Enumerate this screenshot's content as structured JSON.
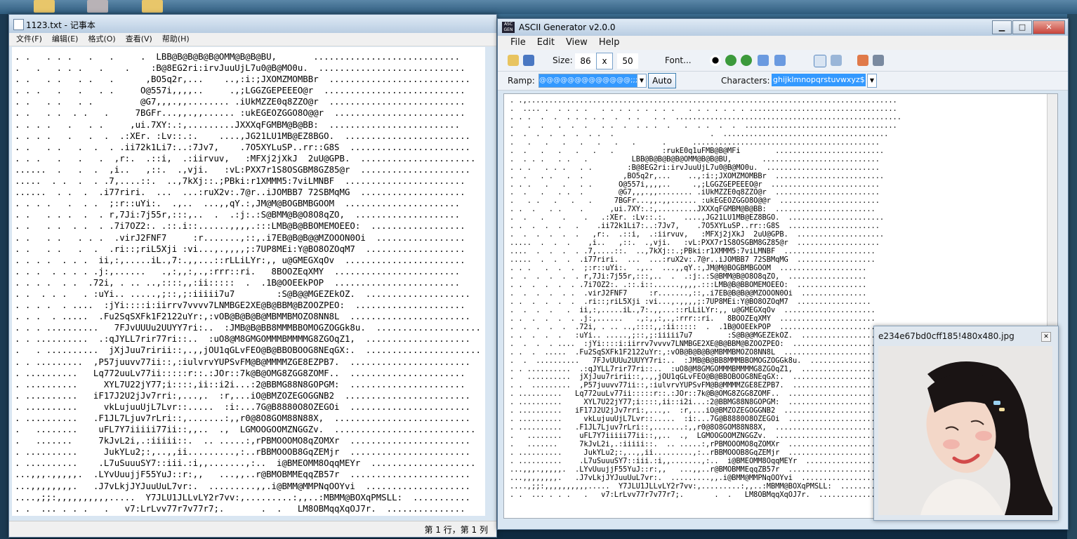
{
  "notepad": {
    "title": "1123.txt - 记事本",
    "menu": [
      "文件(F)",
      "编辑(E)",
      "格式(O)",
      "查看(V)",
      "帮助(H)"
    ],
    "status": "第 1 行，第 1 列",
    "text": ". .   . . .   .   .     .  LBB@B@B@B@B@OMM@B@B@BU,       ............................\n.   .   . . .   .    .    :B@8EG2ri:irvJuuUjL7u0@B@MO0u.  ............................\n. .   . .   . .   .      ,BO5q2r,...    ..,:i:;JXOMZMOMBBr  ...........................\n. . .   .   .   . .     O@557i,,,,..     .,;LGGZGEPEEEO@r  ...........................\n. .   . .   . .         @G7,,,.,,........ .iUkMZZE0q8ZZO@r  ..........................\n. .   . .  . .   .     7BGFr...,,.,,...... :ukEGEOZGGO8O@@r  .........................\n. . . .   .   . .     ,ui.7XY:.:,.........JXXXqFGMBM@B@BB:  .........................\n. . . .   .   .  .  .:XEr. :Lv::.:.    ....,JG21LU1MB@EZ8BGO.  ........................\n. .   . .   .  .  . .ii72k1Li7:..:7Jv7,    .7O5XYLuSP..rr::G8S  .......................\n. . .   .   .   .  ,r:.  .::i,  .:iirvuv,   :MFXj2jXkJ  2uU@GPB.  ......................\n......  .   .  .  ,i..   ,::.  .,vji.   :vL:PXX7r1S8OSGBM8GZ85@r  .....................\n.....  . .  .  . .7,....::.  ..,7kXj::.;PBki:r1XMMM5:7viLMNBF  .......................\n......  . .  .  .i77riri.  ...  ...:ruX2v:.7@r..iJOMBB7 72SBMqMG  ....................\n. . . .   .  . .  ;:r::uYi:.  .,..  ...,,qY.:,JM@M@BOGBMBGOOM  ......................\n. .   . . .  .  . r,7Ji:7j55r,:::,..  .  .:j:.:S@BMM@B@O8O8qZO,  ....................\n. .   . .  . .  . .7i7OZ2:. .::.i::......,,,,.:::LMB@B@BBOMEMOEEO:  ..................\n. .   . .   . . .  .virJ2FNF7     :r.......,::,.i7EB@B@B@@MZOOON0Oi  .................\n. .   . .   .  .  .ri::;riL5Xji :vi...,.,,,,;:7UP8MEi:Y@BO8OZOqM7  ...................\n. . . .  . . .  ii,:,.....iL.,7:.,,...::rLLiLYr:,, u@GMEGXqOv  .......................\n. . .  . . . . .j:,......   .,:,,:,.,:rrr::ri.   8BOOZEqXMY  ........................\n. . . .  . .  .72i, . .. ..,::::,,:ii:::::  .  .1B@OOEEkPOP  ........................\n. .  . . .   . :uYi.. .....,;::,;:iiiii7u7        :S@B@@MGEZEkOZ.  ....................\n. . . .  . ....  :jYi::::i:iirrv7vvvv7LNMBGE2XE@B@BBM@BZOOZPEO:  .....................\n. . .  . .....  .Fu2SqSXFk1F2122uYr:,:vOB@B@B@B@MBMMBMOZO8NN8L  .......................\n. . . ..........   7FJvUUUu2UUYY7ri:..  :JMB@B@BB8MMMBBOMOGZOGGk8u.  ....................\n. . ..........  .:qJYLL7rir77ri::..  :uO8@M8GMGOMMMBMMMMG8ZGOqZ1,  ....................\n.   . ..........  jXjJuu7ririi::,.,,jOU1qGLvFEO@B@BBOBOOG8NEqGX:.  ......................\n. . .........  ,P57juuvv77ii::,:iulvrvYUPSvFM@B@MMMMZGE8EZPB7.  .......................\n. ..........   Lq772uuLv77ii:::::r::.:JOr::7k@B@OMG8ZGG8ZOMF..  ......................\n. ..........     XYL7U22jY77;i::::,ii::i2i...:2@BBMG88N8GOPGM:  ......................\n. ..........   iF17J2U2jJv7rri:,...,.  :r,...iO@BMZOZEGOGGNB2  ........................\n. ..........     vkLujuuUjL7Lvr::.....  :i:...7G@B8880O8OZEGOi  .......................\n. ..........   .F1JL7Ljuv7rLri::,.......:,,r0@8O8GOM88N88X,  ..........................\n.   ........    uFL7Y7iiiii77ii::,,..  .,  LGMOOGOOMZNGGZv.  ...........................\n.   .......     7kJvL2i,.:iiiii::.  .. .....:,rPBMOOOMO8qZOMXr  .......................\n. ..........     JukYLu2;:,..,,ii.........,:..rBBMOOOB8GqZEMjr  .......................\n. ..........    .L7uSuuuSY7::iii.:i,,.......,:..  i@BMEOMM8OqqMEYr  ....................\n...,,,.,,,,,.  .LYvUuujjF55YuJ::r:,,   ...,,..r@BMOBMMEqqZB57r  .......................\n...,,,,,,,,.   .J7vLkjJYJuuUuL7vr:.  .........,,.i@BMM@MMPNqOOYvi  ....................\n....,;;:,,,,,,,,,,.....  Y7JLU1JLLvLY2r7vv:,.........:,,..:MBMM@BOXqPMSLL:  ...........\n. .  ... . . .   .   v7:LrLvv77r7v77r7;.       .  .   LM8OBMqqXqOJ7r.  ..............."
  },
  "ascii_gen": {
    "title": "ASCII Generator v2.0.0",
    "menu": [
      "File",
      "Edit",
      "View",
      "Help"
    ],
    "size_label": "Size:",
    "width": "86",
    "x_label": "x",
    "height": "50",
    "font_label": "Font...",
    "ramp_label": "Ramp:",
    "ramp_value": "@@@@@@@@@@@@@;;;;,,,,,,,,,,",
    "auto_label": "Auto",
    "characters_label": "Characters:",
    "characters_value": "ghijklmnopqrstuvwxyz$",
    "output": ". .,.....................................................................................\n.  .... .  . . . .   . . . . . . . . .   . . . . . . . ..................................\n. . .  .  .  . . . . .  .  . .   . .  ....................................................\n.   .  .   .  .  .   . .  .  . . .  .   .  . .  .  .  ...................................\n.  .  .  .  .  .  . .  .                      .  ......................................\n.   .   .   .   .   .   .   .      .      ...........................................\n.  .   .   .   .   .   .           :rukE0q1uFMB@B@MFi        .........................\n.  . . .   . .   .          LBB@B@B@B@B@OMM@B@B@BU,       ...........................\n. . .   . . .   . .        :B@8EG2ri:irvJuuUjL7u0@B@MO0u.  ..........................\n.  .   . .   .  .         ,BO5q2r,...    ..,:i:;JXOMZMOMBBr  .........................\n. . .   .   .   . .      O@557i,,,,..     .,;LGGZGEPEEEO@r  .........................\n.  .   .   . .  .        @G7,,,.,,........ .iUkMZZE0q8ZZO@r  ........................\n.   . .   .   .   .     7BGFr...,,.,,...... :ukEGEOZGGO8O@@r  .......................\n. .  .   . .    .      ,ui.7XY:.:,.........JXXXqFGMBM@B@BB:  .......................\n.  .   .    .    .   .:XEr. :Lv::.:.    ....,JG21LU1MB@EZ8BGO.  ......................\n. .  .  .  .   .    .ii72k1Li7:..:7Jv7,    .7O5XYLuSP..rr::G8S  .....................\n.  .  .  .  .  .   ,r:.  .::i,  .:iirvuv,   :MFXj2jXkJ  2uU@GPB.  ....................\n.....  .  .  .    ,i..   ,::.  .,vji.   :vL:PXX7r1S8OSGBM8GZ85@r  ...................\n....  .  .  .  . .7,....::.  ..,7kXj::.;PBki:r1XMMM5:7viLMNBF  .....................\n.....  .  .  .  .i77riri.  ...  ...:ruX2v:.7@r..iJOMBB7 72SBMqMG  ..................\n. . .   .  .  .  ;:r::uYi:.  .,..  ...,,qY.:,JM@M@BOGBMBGOOM  ....................\n.  .  .  .  .  . r,7Ji:7j55r,:::,..  .  .:j:.:S@BMM@B@O8O8qZO,  ..................\n. .  .  .  .  . .7i7OZ2:. .::.i::......,,,,.:::LMB@B@BBOMEMOEEO:  ................\n.  .  .  .  . .  .virJ2FNF7     :r.......,::,.i7EB@B@B@@MZOOON0Oi  ...............\n. .  .  .  .  .  .ri::;riL5Xji :vi...,.,,,,;:7UP8MEi:Y@BO8OZOqM7  .................\n.  .  .  .   .  ii,:,.....iL.,7:.,,...::rLLiLYr:,, u@GMEGXqOv  .....................\n. .  .  .  .  . .j:,......   .,:,,:,.,:rrr::ri.   8BOOZEqXMY  ......................\n.  .  .  .  .  .72i, . .. ..,::::,,:ii:::::  .  .1B@OOEEkPOP  ......................\n. .  .  .  .   :uYi.. .....,;::,;:iiiii7u7        :S@B@@MGEZEkOZ.  ..................\n.  .  .  . ....  :jYi::::i:iirrv7vvvv7LNMBGE2XE@B@BBM@BZOOZPEO:  ...................\n. .  .  .....  .Fu2SqSXFk1F2122uYr:,:vOB@B@B@B@MBMMBMOZO8NN8L  .....................\n.  .  ..........   7FJvUUUu2UUYY7ri:..  :JMB@B@BB8MMMBBOMOGZOGGk8u.  ..................\n. . ..........  .:qJYLL7rir77ri::..  :uO8@M8GMGOMMMBMMMMG8ZGOqZ1,  ..................\n.   ..........  jXjJuu7ririi::,.,,jOU1qGLvFEO@B@BBOBOOG8NEqGX:.  ....................\n. .  .........  ,P57juuvv77ii::,:iulvrvYUPSvFM@B@MMMMZGE8EZPB7.  .....................\n. ..........   Lq772uuLv77ii:::::r::.:JOr::7k@B@OMG8ZGG8ZOMF..  ....................\n. ..........     XYL7U22jY77;i::::,ii::i2i...:2@BBMG88N8GOPGM:  ....................\n. ..........   iF17J2U2jJv7rri:,...,.  :r,...iO@BMZOZEGOGGNB2  ......................\n. ..........     vkLujuuUjL7Lvr::.....  :i:...7G@B8880O8OZEGOi  .....................\n. ..........   .F1JL7Ljuv7rLri::,.......:,,r0@8O8GOM88N88X,  ........................\n.   ........    uFL7Y7iiiii77ii::,,..  .,  LGMOOGOOMZNGGZv.  .........................\n.   .......     7kJvL2i,.:iiiii::.  .. .....:,rPBMOOOMO8qZOMXr  .....................\n. ..........     JukYLu2;:,..,,ii.........,:..rBBMOOOB8GqZEMjr  .....................\n. ..........    .L7uSuuuSY7::iii.:i,,.......,:..  i@BMEOMM8OqqMEYr  ..................\n...,,,.,,,,,.  .LYvUuujjF55YuJ::r:,,   ...,,..r@BMOBMMEqqZB57r  .....................\n...,,,,,,,,.   .J7vLkjJYJuuUuL7vr:.  .........,,.i@BMM@MMPNqOOYvi  ..................\n....,;;:,,,,,,,,,,.....  Y7JLU1JLLvLY2r7vv:,.........:,,..:MBMM@BOXqPMSLL:  .........\n. .  ... . . .   .   v7:LrLvv77r7v77r7;.       .  .   LM8OBMqqXqOJ7r.  ............."
  },
  "image_viewer": {
    "title": "e234e67bd0cff185!480x480.jpg"
  }
}
